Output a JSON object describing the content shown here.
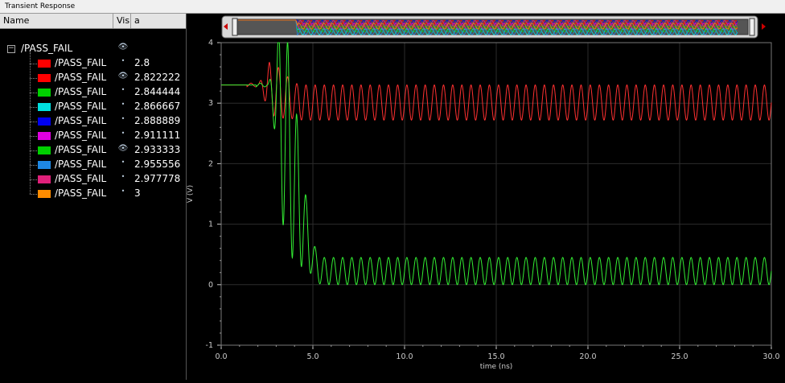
{
  "window": {
    "title": "Transient Response"
  },
  "columns": {
    "name": "Name",
    "vis": "Vis",
    "a": "a"
  },
  "tree": {
    "root_label": "/PASS_FAIL",
    "items": [
      {
        "label": "/PASS_FAIL",
        "value": "2.8",
        "color": "#ff0000",
        "visible": false
      },
      {
        "label": "/PASS_FAIL",
        "value": "2.822222",
        "color": "#ff0000",
        "visible": true
      },
      {
        "label": "/PASS_FAIL",
        "value": "2.844444",
        "color": "#00d000",
        "visible": false
      },
      {
        "label": "/PASS_FAIL",
        "value": "2.866667",
        "color": "#00e0e0",
        "visible": false
      },
      {
        "label": "/PASS_FAIL",
        "value": "2.888889",
        "color": "#0000ee",
        "visible": false
      },
      {
        "label": "/PASS_FAIL",
        "value": "2.911111",
        "color": "#e000e0",
        "visible": false
      },
      {
        "label": "/PASS_FAIL",
        "value": "2.933333",
        "color": "#00d000",
        "visible": true
      },
      {
        "label": "/PASS_FAIL",
        "value": "2.955556",
        "color": "#1e88e5",
        "visible": false
      },
      {
        "label": "/PASS_FAIL",
        "value": "2.977778",
        "color": "#e0207a",
        "visible": false
      },
      {
        "label": "/PASS_FAIL",
        "value": "3",
        "color": "#ff8c00",
        "visible": false
      }
    ]
  },
  "chart_data": {
    "type": "line",
    "xlabel": "time (ns)",
    "ylabel": "V (V)",
    "xlim": [
      0,
      30
    ],
    "ylim": [
      -1,
      4
    ],
    "xticks": [
      "0.0",
      "5.0",
      "10.0",
      "15.0",
      "20.0",
      "25.0",
      "30.0"
    ],
    "yticks": [
      "-1",
      "0",
      "1",
      "2",
      "3",
      "4"
    ],
    "grid": true,
    "series": [
      {
        "color": "#ff3030",
        "initial_level": 3.3,
        "transition_start_ns": 2.0,
        "settle_ns": 4.5,
        "steady_high": 3.3,
        "steady_low": 2.72,
        "period_ns": 0.5
      },
      {
        "color": "#33ee33",
        "initial_level": 3.3,
        "transition_start_ns": 2.5,
        "settle_ns": 5.5,
        "steady_high": 0.45,
        "steady_low": 0.0,
        "period_ns": 0.5
      }
    ]
  },
  "colors": {
    "background": "#000000",
    "grid": "#2c2c2c",
    "axis": "#cccccc"
  }
}
